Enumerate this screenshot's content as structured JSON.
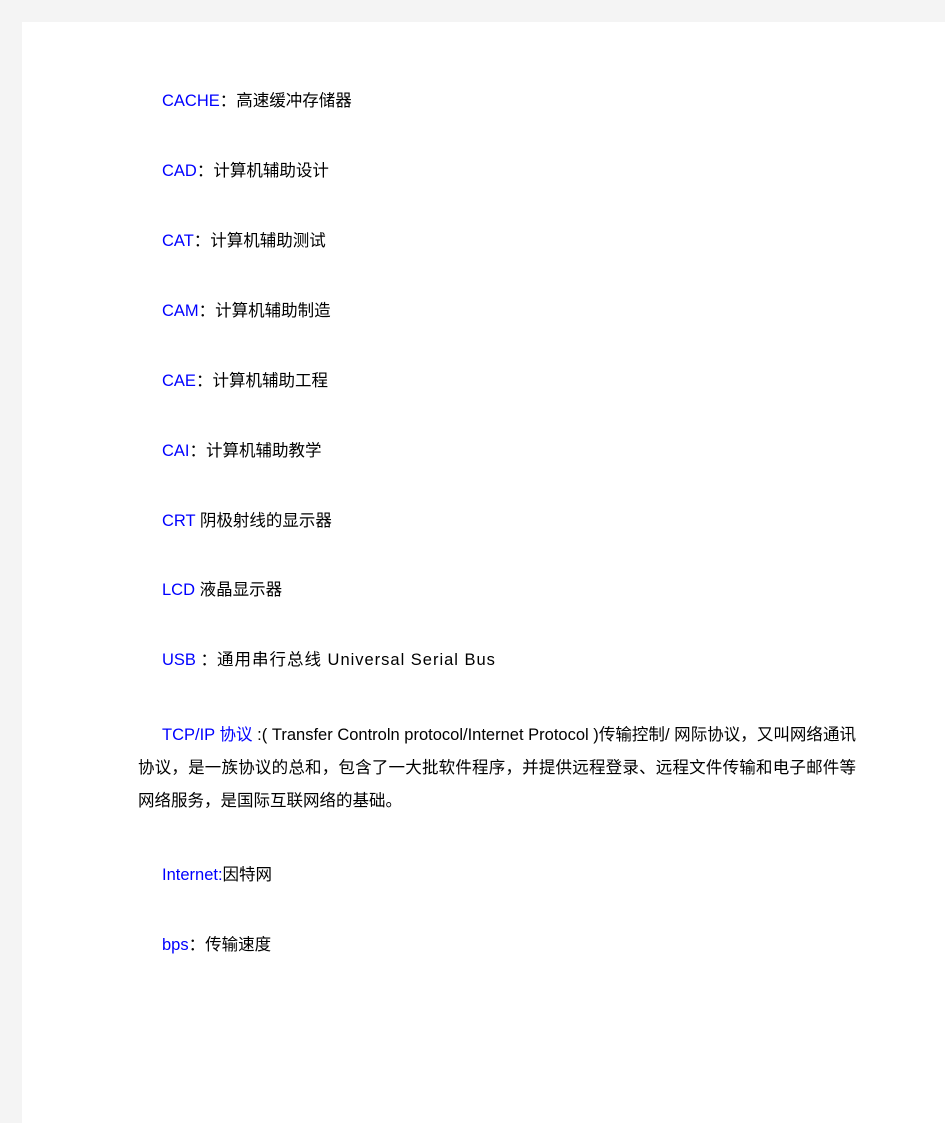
{
  "document": {
    "background_color": "#f4f4f4",
    "page_color": "#ffffff",
    "term_color": "#0000ff",
    "text_color": "#000000",
    "entries": [
      {
        "id": "cache",
        "term": "CACHE",
        "separator": "：",
        "definition": "高速缓冲存储器"
      },
      {
        "id": "cad",
        "term": "CAD",
        "separator": "：",
        "definition": "计算机辅助设计"
      },
      {
        "id": "cat",
        "term": "CAT",
        "separator": "：",
        "definition": "计算机辅助测试"
      },
      {
        "id": "cam",
        "term": "CAM",
        "separator": "：",
        "definition": "计算机辅助制造"
      },
      {
        "id": "cae",
        "term": "CAE",
        "separator": "：",
        "definition": "计算机辅助工程"
      },
      {
        "id": "cai",
        "term": "CAI",
        "separator": "：",
        "definition": "计算机辅助教学"
      },
      {
        "id": "crt",
        "term": "CRT",
        "separator": " ",
        "definition": "阴极射线的显示器"
      },
      {
        "id": "lcd",
        "term": "LCD",
        "separator": " ",
        "definition": "液晶显示器"
      },
      {
        "id": "usb",
        "term": "USB",
        "separator": " ：",
        "definition": "通用串行总线 Universal Serial Bus"
      }
    ],
    "paragraph": {
      "id": "tcpip",
      "term": "TCP/IP 协议",
      "body": " :( Transfer Controln protocol/Internet Protocol )传输控制/ 网际协议，又叫网络通讯协议，是一族协议的总和，包含了一大批软件程序，并提供远程登录、远程文件传输和电子邮件等网络服务，是国际互联网络的基础。"
    },
    "entries_tail": [
      {
        "id": "internet",
        "term": "Internet:",
        "separator": "",
        "definition": "因特网"
      },
      {
        "id": "bps",
        "term": "bps",
        "separator": "：",
        "definition": "传输速度"
      }
    ]
  }
}
